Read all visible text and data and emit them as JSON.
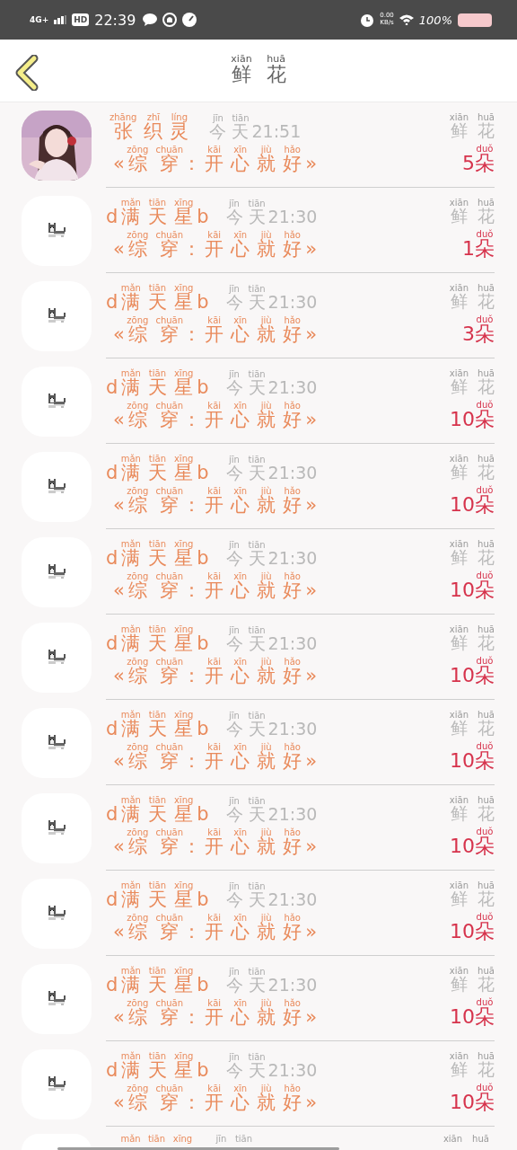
{
  "status_bar": {
    "network": "4G+",
    "hd": "HD",
    "time": "22:39",
    "speed_value": "0.00",
    "speed_unit": "KB/s",
    "battery": "100%"
  },
  "header": {
    "title": [
      {
        "t": "鲜",
        "py": "xiān"
      },
      {
        "t": "花",
        "py": "huā"
      }
    ]
  },
  "rows": [
    {
      "avatar": {
        "kind": "picture"
      },
      "name": [
        {
          "t": "张",
          "py": "zhāng"
        },
        {
          "t": "织",
          "py": "zhī"
        },
        {
          "t": "灵",
          "py": "líng"
        }
      ],
      "time": [
        {
          "t": "今",
          "py": "jīn"
        },
        {
          "t": "天",
          "py": "tiān"
        },
        {
          "t": "21:51"
        }
      ],
      "book": [
        {
          "t": "«"
        },
        {
          "t": "综",
          "py": "zōng"
        },
        {
          "t": "穿",
          "py": "chuān"
        },
        {
          "t": "："
        },
        {
          "t": "开",
          "py": "kāi"
        },
        {
          "t": "心",
          "py": "xīn"
        },
        {
          "t": "就",
          "py": "jiù"
        },
        {
          "t": "好",
          "py": "hǎo"
        },
        {
          "t": "»"
        }
      ],
      "label": [
        {
          "t": "鲜",
          "py": "xiān"
        },
        {
          "t": "花",
          "py": "huā"
        }
      ],
      "count": [
        {
          "t": "5"
        },
        {
          "t": "朵",
          "py": "duǒ"
        }
      ]
    },
    {
      "avatar": {
        "kind": "dog"
      },
      "name": [
        {
          "t": "d"
        },
        {
          "t": "满",
          "py": "mǎn"
        },
        {
          "t": "天",
          "py": "tiān"
        },
        {
          "t": "星",
          "py": "xīng"
        },
        {
          "t": "b"
        }
      ],
      "time": [
        {
          "t": "今",
          "py": "jīn"
        },
        {
          "t": "天",
          "py": "tiān"
        },
        {
          "t": "21:30"
        }
      ],
      "book": [
        {
          "t": "«"
        },
        {
          "t": "综",
          "py": "zōng"
        },
        {
          "t": "穿",
          "py": "chuān"
        },
        {
          "t": "："
        },
        {
          "t": "开",
          "py": "kāi"
        },
        {
          "t": "心",
          "py": "xīn"
        },
        {
          "t": "就",
          "py": "jiù"
        },
        {
          "t": "好",
          "py": "hǎo"
        },
        {
          "t": "»"
        }
      ],
      "label": [
        {
          "t": "鲜",
          "py": "xiān"
        },
        {
          "t": "花",
          "py": "huā"
        }
      ],
      "count": [
        {
          "t": "1"
        },
        {
          "t": "朵",
          "py": "duǒ"
        }
      ]
    },
    {
      "avatar": {
        "kind": "dog"
      },
      "name": [
        {
          "t": "d"
        },
        {
          "t": "满",
          "py": "mǎn"
        },
        {
          "t": "天",
          "py": "tiān"
        },
        {
          "t": "星",
          "py": "xīng"
        },
        {
          "t": "b"
        }
      ],
      "time": [
        {
          "t": "今",
          "py": "jīn"
        },
        {
          "t": "天",
          "py": "tiān"
        },
        {
          "t": "21:30"
        }
      ],
      "book": [
        {
          "t": "«"
        },
        {
          "t": "综",
          "py": "zōng"
        },
        {
          "t": "穿",
          "py": "chuān"
        },
        {
          "t": "："
        },
        {
          "t": "开",
          "py": "kāi"
        },
        {
          "t": "心",
          "py": "xīn"
        },
        {
          "t": "就",
          "py": "jiù"
        },
        {
          "t": "好",
          "py": "hǎo"
        },
        {
          "t": "»"
        }
      ],
      "label": [
        {
          "t": "鲜",
          "py": "xiān"
        },
        {
          "t": "花",
          "py": "huā"
        }
      ],
      "count": [
        {
          "t": "3"
        },
        {
          "t": "朵",
          "py": "duǒ"
        }
      ]
    },
    {
      "avatar": {
        "kind": "dog"
      },
      "name": [
        {
          "t": "d"
        },
        {
          "t": "满",
          "py": "mǎn"
        },
        {
          "t": "天",
          "py": "tiān"
        },
        {
          "t": "星",
          "py": "xīng"
        },
        {
          "t": "b"
        }
      ],
      "time": [
        {
          "t": "今",
          "py": "jīn"
        },
        {
          "t": "天",
          "py": "tiān"
        },
        {
          "t": "21:30"
        }
      ],
      "book": [
        {
          "t": "«"
        },
        {
          "t": "综",
          "py": "zōng"
        },
        {
          "t": "穿",
          "py": "chuān"
        },
        {
          "t": "："
        },
        {
          "t": "开",
          "py": "kāi"
        },
        {
          "t": "心",
          "py": "xīn"
        },
        {
          "t": "就",
          "py": "jiù"
        },
        {
          "t": "好",
          "py": "hǎo"
        },
        {
          "t": "»"
        }
      ],
      "label": [
        {
          "t": "鲜",
          "py": "xiān"
        },
        {
          "t": "花",
          "py": "huā"
        }
      ],
      "count": [
        {
          "t": "10"
        },
        {
          "t": "朵",
          "py": "duǒ"
        }
      ]
    },
    {
      "avatar": {
        "kind": "dog"
      },
      "name": [
        {
          "t": "d"
        },
        {
          "t": "满",
          "py": "mǎn"
        },
        {
          "t": "天",
          "py": "tiān"
        },
        {
          "t": "星",
          "py": "xīng"
        },
        {
          "t": "b"
        }
      ],
      "time": [
        {
          "t": "今",
          "py": "jīn"
        },
        {
          "t": "天",
          "py": "tiān"
        },
        {
          "t": "21:30"
        }
      ],
      "book": [
        {
          "t": "«"
        },
        {
          "t": "综",
          "py": "zōng"
        },
        {
          "t": "穿",
          "py": "chuān"
        },
        {
          "t": "："
        },
        {
          "t": "开",
          "py": "kāi"
        },
        {
          "t": "心",
          "py": "xīn"
        },
        {
          "t": "就",
          "py": "jiù"
        },
        {
          "t": "好",
          "py": "hǎo"
        },
        {
          "t": "»"
        }
      ],
      "label": [
        {
          "t": "鲜",
          "py": "xiān"
        },
        {
          "t": "花",
          "py": "huā"
        }
      ],
      "count": [
        {
          "t": "10"
        },
        {
          "t": "朵",
          "py": "duǒ"
        }
      ]
    },
    {
      "avatar": {
        "kind": "dog"
      },
      "name": [
        {
          "t": "d"
        },
        {
          "t": "满",
          "py": "mǎn"
        },
        {
          "t": "天",
          "py": "tiān"
        },
        {
          "t": "星",
          "py": "xīng"
        },
        {
          "t": "b"
        }
      ],
      "time": [
        {
          "t": "今",
          "py": "jīn"
        },
        {
          "t": "天",
          "py": "tiān"
        },
        {
          "t": "21:30"
        }
      ],
      "book": [
        {
          "t": "«"
        },
        {
          "t": "综",
          "py": "zōng"
        },
        {
          "t": "穿",
          "py": "chuān"
        },
        {
          "t": "："
        },
        {
          "t": "开",
          "py": "kāi"
        },
        {
          "t": "心",
          "py": "xīn"
        },
        {
          "t": "就",
          "py": "jiù"
        },
        {
          "t": "好",
          "py": "hǎo"
        },
        {
          "t": "»"
        }
      ],
      "label": [
        {
          "t": "鲜",
          "py": "xiān"
        },
        {
          "t": "花",
          "py": "huā"
        }
      ],
      "count": [
        {
          "t": "10"
        },
        {
          "t": "朵",
          "py": "duǒ"
        }
      ]
    },
    {
      "avatar": {
        "kind": "dog"
      },
      "name": [
        {
          "t": "d"
        },
        {
          "t": "满",
          "py": "mǎn"
        },
        {
          "t": "天",
          "py": "tiān"
        },
        {
          "t": "星",
          "py": "xīng"
        },
        {
          "t": "b"
        }
      ],
      "time": [
        {
          "t": "今",
          "py": "jīn"
        },
        {
          "t": "天",
          "py": "tiān"
        },
        {
          "t": "21:30"
        }
      ],
      "book": [
        {
          "t": "«"
        },
        {
          "t": "综",
          "py": "zōng"
        },
        {
          "t": "穿",
          "py": "chuān"
        },
        {
          "t": "："
        },
        {
          "t": "开",
          "py": "kāi"
        },
        {
          "t": "心",
          "py": "xīn"
        },
        {
          "t": "就",
          "py": "jiù"
        },
        {
          "t": "好",
          "py": "hǎo"
        },
        {
          "t": "»"
        }
      ],
      "label": [
        {
          "t": "鲜",
          "py": "xiān"
        },
        {
          "t": "花",
          "py": "huā"
        }
      ],
      "count": [
        {
          "t": "10"
        },
        {
          "t": "朵",
          "py": "duǒ"
        }
      ]
    },
    {
      "avatar": {
        "kind": "dog"
      },
      "name": [
        {
          "t": "d"
        },
        {
          "t": "满",
          "py": "mǎn"
        },
        {
          "t": "天",
          "py": "tiān"
        },
        {
          "t": "星",
          "py": "xīng"
        },
        {
          "t": "b"
        }
      ],
      "time": [
        {
          "t": "今",
          "py": "jīn"
        },
        {
          "t": "天",
          "py": "tiān"
        },
        {
          "t": "21:30"
        }
      ],
      "book": [
        {
          "t": "«"
        },
        {
          "t": "综",
          "py": "zōng"
        },
        {
          "t": "穿",
          "py": "chuān"
        },
        {
          "t": "："
        },
        {
          "t": "开",
          "py": "kāi"
        },
        {
          "t": "心",
          "py": "xīn"
        },
        {
          "t": "就",
          "py": "jiù"
        },
        {
          "t": "好",
          "py": "hǎo"
        },
        {
          "t": "»"
        }
      ],
      "label": [
        {
          "t": "鲜",
          "py": "xiān"
        },
        {
          "t": "花",
          "py": "huā"
        }
      ],
      "count": [
        {
          "t": "10"
        },
        {
          "t": "朵",
          "py": "duǒ"
        }
      ]
    },
    {
      "avatar": {
        "kind": "dog"
      },
      "name": [
        {
          "t": "d"
        },
        {
          "t": "满",
          "py": "mǎn"
        },
        {
          "t": "天",
          "py": "tiān"
        },
        {
          "t": "星",
          "py": "xīng"
        },
        {
          "t": "b"
        }
      ],
      "time": [
        {
          "t": "今",
          "py": "jīn"
        },
        {
          "t": "天",
          "py": "tiān"
        },
        {
          "t": "21:30"
        }
      ],
      "book": [
        {
          "t": "«"
        },
        {
          "t": "综",
          "py": "zōng"
        },
        {
          "t": "穿",
          "py": "chuān"
        },
        {
          "t": "："
        },
        {
          "t": "开",
          "py": "kāi"
        },
        {
          "t": "心",
          "py": "xīn"
        },
        {
          "t": "就",
          "py": "jiù"
        },
        {
          "t": "好",
          "py": "hǎo"
        },
        {
          "t": "»"
        }
      ],
      "label": [
        {
          "t": "鲜",
          "py": "xiān"
        },
        {
          "t": "花",
          "py": "huā"
        }
      ],
      "count": [
        {
          "t": "10"
        },
        {
          "t": "朵",
          "py": "duǒ"
        }
      ]
    },
    {
      "avatar": {
        "kind": "dog"
      },
      "name": [
        {
          "t": "d"
        },
        {
          "t": "满",
          "py": "mǎn"
        },
        {
          "t": "天",
          "py": "tiān"
        },
        {
          "t": "星",
          "py": "xīng"
        },
        {
          "t": "b"
        }
      ],
      "time": [
        {
          "t": "今",
          "py": "jīn"
        },
        {
          "t": "天",
          "py": "tiān"
        },
        {
          "t": "21:30"
        }
      ],
      "book": [
        {
          "t": "«"
        },
        {
          "t": "综",
          "py": "zōng"
        },
        {
          "t": "穿",
          "py": "chuān"
        },
        {
          "t": "："
        },
        {
          "t": "开",
          "py": "kāi"
        },
        {
          "t": "心",
          "py": "xīn"
        },
        {
          "t": "就",
          "py": "jiù"
        },
        {
          "t": "好",
          "py": "hǎo"
        },
        {
          "t": "»"
        }
      ],
      "label": [
        {
          "t": "鲜",
          "py": "xiān"
        },
        {
          "t": "花",
          "py": "huā"
        }
      ],
      "count": [
        {
          "t": "10"
        },
        {
          "t": "朵",
          "py": "duǒ"
        }
      ]
    },
    {
      "avatar": {
        "kind": "dog"
      },
      "name": [
        {
          "t": "d"
        },
        {
          "t": "满",
          "py": "mǎn"
        },
        {
          "t": "天",
          "py": "tiān"
        },
        {
          "t": "星",
          "py": "xīng"
        },
        {
          "t": "b"
        }
      ],
      "time": [
        {
          "t": "今",
          "py": "jīn"
        },
        {
          "t": "天",
          "py": "tiān"
        },
        {
          "t": "21:30"
        }
      ],
      "book": [
        {
          "t": "«"
        },
        {
          "t": "综",
          "py": "zōng"
        },
        {
          "t": "穿",
          "py": "chuān"
        },
        {
          "t": "："
        },
        {
          "t": "开",
          "py": "kāi"
        },
        {
          "t": "心",
          "py": "xīn"
        },
        {
          "t": "就",
          "py": "jiù"
        },
        {
          "t": "好",
          "py": "hǎo"
        },
        {
          "t": "»"
        }
      ],
      "label": [
        {
          "t": "鲜",
          "py": "xiān"
        },
        {
          "t": "花",
          "py": "huā"
        }
      ],
      "count": [
        {
          "t": "10"
        },
        {
          "t": "朵",
          "py": "duǒ"
        }
      ]
    },
    {
      "avatar": {
        "kind": "dog"
      },
      "name": [
        {
          "t": "d"
        },
        {
          "t": "满",
          "py": "mǎn"
        },
        {
          "t": "天",
          "py": "tiān"
        },
        {
          "t": "星",
          "py": "xīng"
        },
        {
          "t": "b"
        }
      ],
      "time": [
        {
          "t": "今",
          "py": "jīn"
        },
        {
          "t": "天",
          "py": "tiān"
        },
        {
          "t": "21:30"
        }
      ],
      "book": [
        {
          "t": "«"
        },
        {
          "t": "综",
          "py": "zōng"
        },
        {
          "t": "穿",
          "py": "chuān"
        },
        {
          "t": "："
        },
        {
          "t": "开",
          "py": "kāi"
        },
        {
          "t": "心",
          "py": "xīn"
        },
        {
          "t": "就",
          "py": "jiù"
        },
        {
          "t": "好",
          "py": "hǎo"
        },
        {
          "t": "»"
        }
      ],
      "label": [
        {
          "t": "鲜",
          "py": "xiān"
        },
        {
          "t": "花",
          "py": "huā"
        }
      ],
      "count": [
        {
          "t": "10"
        },
        {
          "t": "朵",
          "py": "duǒ"
        }
      ]
    }
  ],
  "cut_row": {
    "name_pinyin": [
      "mǎn",
      "tiān",
      "xīng"
    ],
    "time_pinyin": [
      "jīn",
      "tiān"
    ],
    "label_pinyin": [
      "xiān",
      "huā"
    ]
  }
}
